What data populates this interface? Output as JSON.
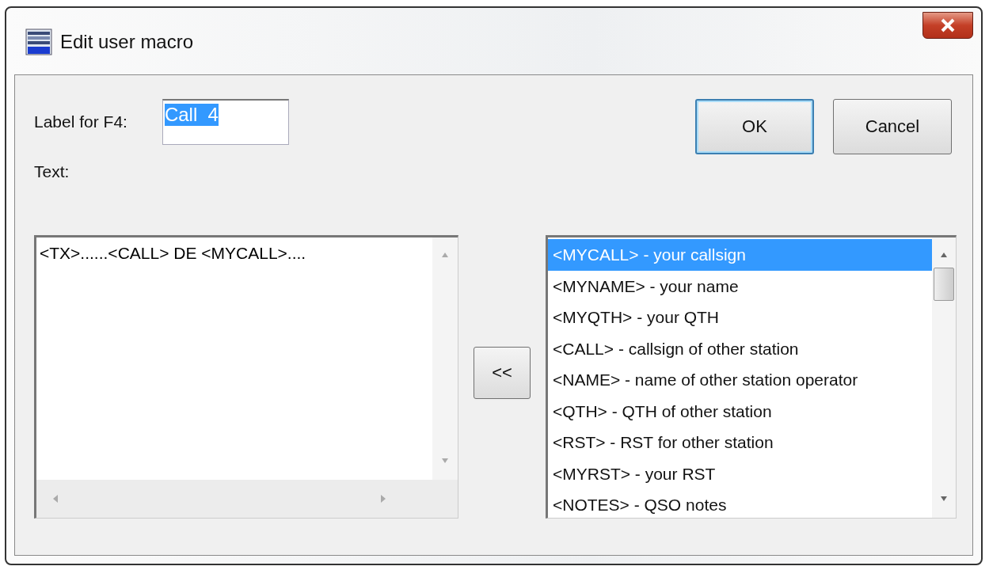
{
  "window": {
    "title": "Edit user macro"
  },
  "label_field": {
    "label": "Label for F4:",
    "value": "Call  4",
    "text_selected": true
  },
  "buttons": [
    {
      "label": "OK",
      "default": true
    },
    {
      "label": "Cancel",
      "default": false
    }
  ],
  "text_label": "Text:",
  "text_area": {
    "value": "<TX>......<CALL> DE <MYCALL>...."
  },
  "insert_button": {
    "label": "<<"
  },
  "macro_list": [
    {
      "label": "<MYCALL> - your callsign",
      "selected": true
    },
    {
      "label": "<MYNAME> - your name",
      "selected": false
    },
    {
      "label": "<MYQTH> - your QTH",
      "selected": false
    },
    {
      "label": "<CALL> - callsign of other station",
      "selected": false
    },
    {
      "label": "<NAME> - name of other station operator",
      "selected": false
    },
    {
      "label": "<QTH> - QTH of other station",
      "selected": false
    },
    {
      "label": "<RST> - RST for other station",
      "selected": false
    },
    {
      "label": "<MYRST> - your RST",
      "selected": false
    },
    {
      "label": "<NOTES> - QSO notes",
      "selected": false
    }
  ]
}
